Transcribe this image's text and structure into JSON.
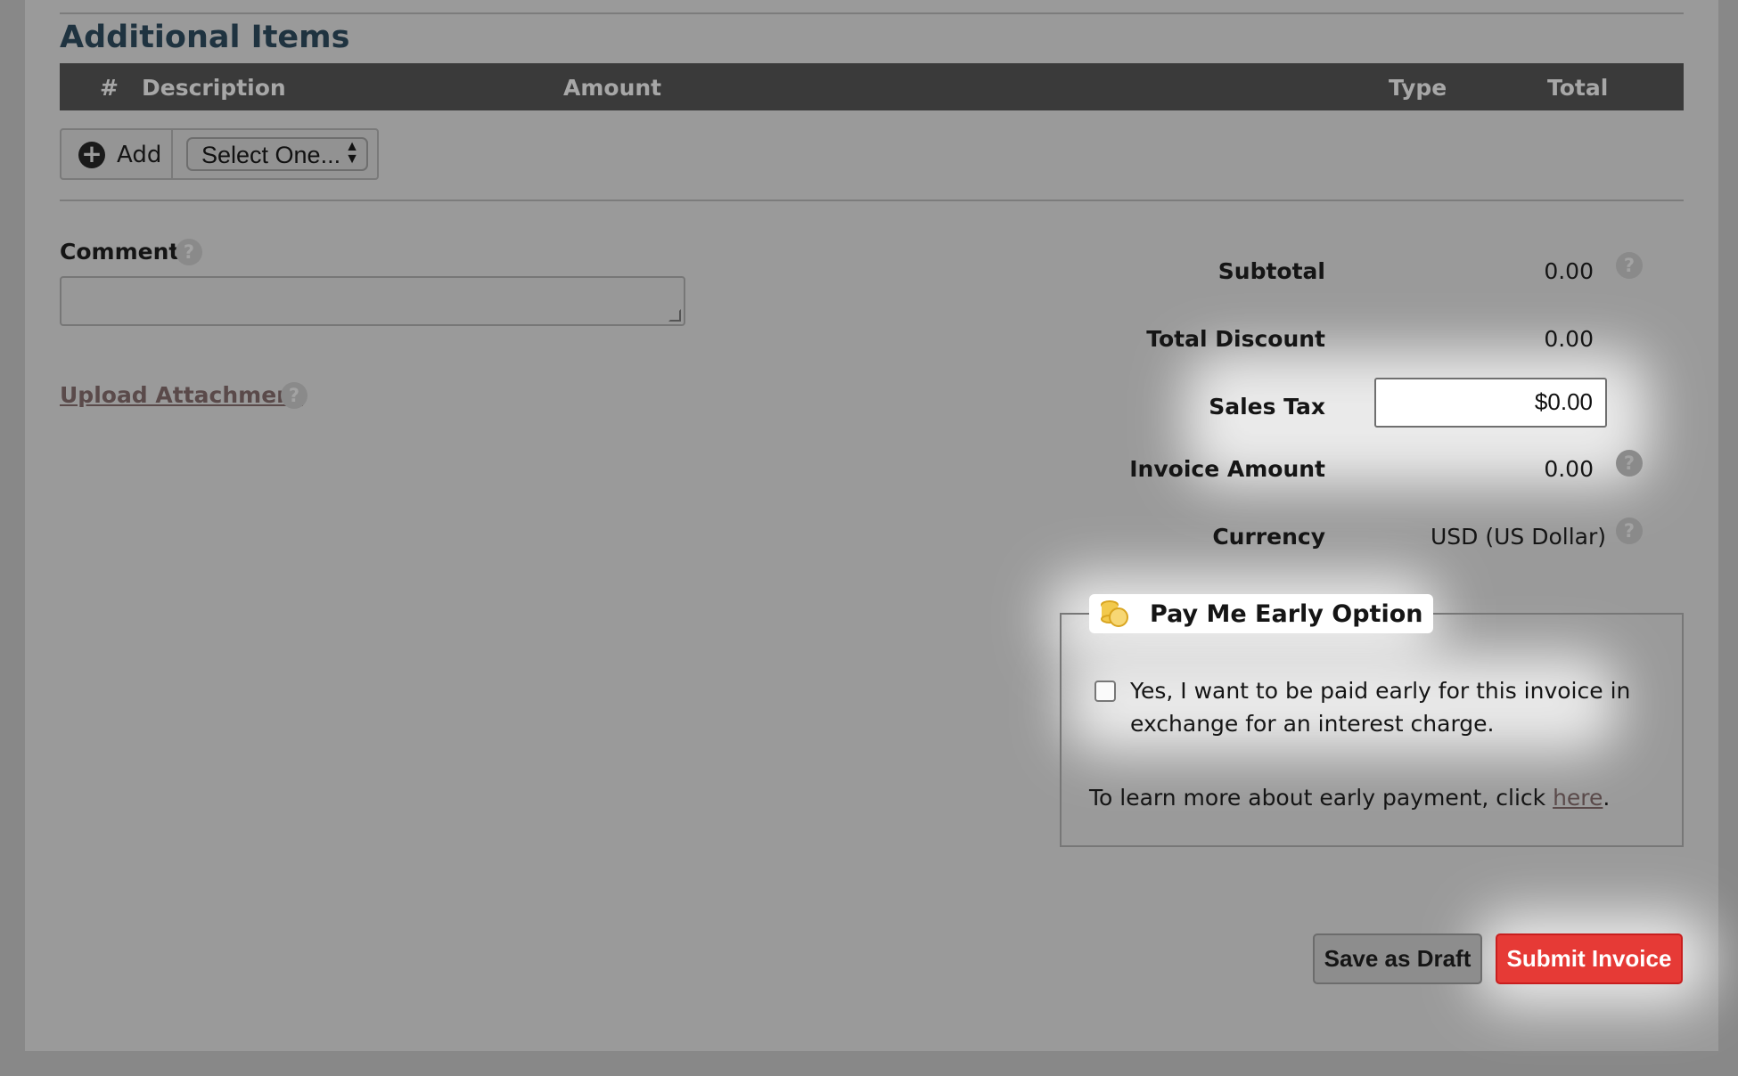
{
  "section": {
    "title": "Additional Items"
  },
  "table": {
    "columns": [
      "#",
      "Description",
      "Amount",
      "Type",
      "Total"
    ]
  },
  "add_row": {
    "add_label": "Add",
    "select_value": "Select One..."
  },
  "comment": {
    "label": "Comment",
    "value": ""
  },
  "upload": {
    "label": "Upload Attachment"
  },
  "summary": {
    "subtotal_label": "Subtotal",
    "subtotal_value": "0.00",
    "discount_label": "Total Discount",
    "discount_value": "0.00",
    "tax_label": "Sales Tax",
    "tax_value": "$0.00",
    "invoice_label": "Invoice Amount",
    "invoice_value": "0.00",
    "currency_label": "Currency",
    "currency_value": "USD (US Dollar)"
  },
  "early_pay": {
    "title": "Pay Me Early Option",
    "checkbox_text": "Yes, I want to be paid early for this invoice in exchange for an interest charge.",
    "checked": false,
    "learn_prefix": "To learn more about early payment, click ",
    "learn_link": "here",
    "learn_suffix": "."
  },
  "actions": {
    "draft_label": "Save as Draft",
    "submit_label": "Submit Invoice"
  },
  "colors": {
    "submit": "#e63a36",
    "header_bar": "#3a3a3a",
    "overlay": "#9a9a9a"
  },
  "icons": {
    "help": "question-circle",
    "add": "plus-circle",
    "coins": "coins"
  }
}
